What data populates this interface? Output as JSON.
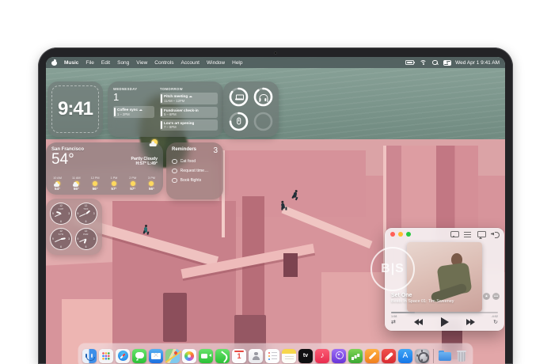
{
  "menubar": {
    "items": [
      "Music",
      "File",
      "Edit",
      "Song",
      "View",
      "Controls",
      "Account",
      "Window",
      "Help"
    ],
    "status": {
      "datetime": "Wed Apr 1  9:41 AM"
    }
  },
  "widgets": {
    "clock": {
      "time": "9:41"
    },
    "calendar": {
      "today_label": "WEDNESDAY",
      "today_date": "1",
      "today_event": {
        "title": "Coffee sync",
        "time": "1 – 2PM"
      },
      "tomorrow_label": "TOMORROW",
      "tomorrow_events": [
        {
          "title": "Pitch meeting",
          "time": "11AM – 12PM"
        },
        {
          "title": "Fundraiser check-in",
          "time": "5 – 6PM"
        },
        {
          "title": "Lou's art opening",
          "time": "7 – 8PM"
        }
      ]
    },
    "batteries": {
      "devices": [
        "laptop",
        "headphones",
        "mouse"
      ],
      "levels_pct": [
        85,
        90,
        75
      ]
    },
    "weather": {
      "city": "San Francisco",
      "temp": "54°",
      "condition": "Partly Cloudy",
      "high_low": "H:57° L:49°",
      "hours": [
        {
          "time": "10 AM",
          "icon": "partly-cloudy",
          "temp": "54°"
        },
        {
          "time": "11 AM",
          "icon": "partly-cloudy",
          "temp": "55°"
        },
        {
          "time": "12 PM",
          "icon": "sunny",
          "temp": "56°"
        },
        {
          "time": "1 PM",
          "icon": "sunny",
          "temp": "57°"
        },
        {
          "time": "2 PM",
          "icon": "sunny",
          "temp": "57°"
        },
        {
          "time": "3 PM",
          "icon": "sunny",
          "temp": "56°"
        }
      ]
    },
    "reminders": {
      "title": "Reminders",
      "count": "3",
      "items": [
        "Cat food",
        "Request time…",
        "Book flights"
      ]
    },
    "world_clock": {
      "cities": [
        "CUP",
        "TOK",
        "SYD",
        "PAR"
      ],
      "numerals": [
        "12",
        "3",
        "6",
        "9"
      ]
    }
  },
  "music_player": {
    "window_icons": [
      "lyrics",
      "queue",
      "airplay",
      "volume"
    ],
    "album_logo": "B|S",
    "track_title": "Set One",
    "track_subtitle": "Beats In Space 01: Tim Sweeney",
    "star_label": "★",
    "more_label": "•••",
    "elapsed": "1:08",
    "remaining": "-4:02",
    "shuffle_glyph": "⇄",
    "repeat_glyph": "↻"
  },
  "dock": {
    "apps": [
      "finder",
      "launchpad",
      "safari",
      "messages",
      "mail",
      "maps",
      "photos",
      "facetime",
      "phone",
      "calendar",
      "contacts",
      "reminders",
      "notes",
      "tv",
      "music",
      "podcasts",
      "numbers",
      "pages",
      "rocket",
      "app-store",
      "settings"
    ],
    "extras": [
      "downloads-folder",
      "trash"
    ],
    "running": [
      "finder",
      "music"
    ],
    "glyphs": {
      "calendar_date": "1",
      "tv_label": "tv",
      "music_note": "♪",
      "appstore_label": "A"
    }
  }
}
